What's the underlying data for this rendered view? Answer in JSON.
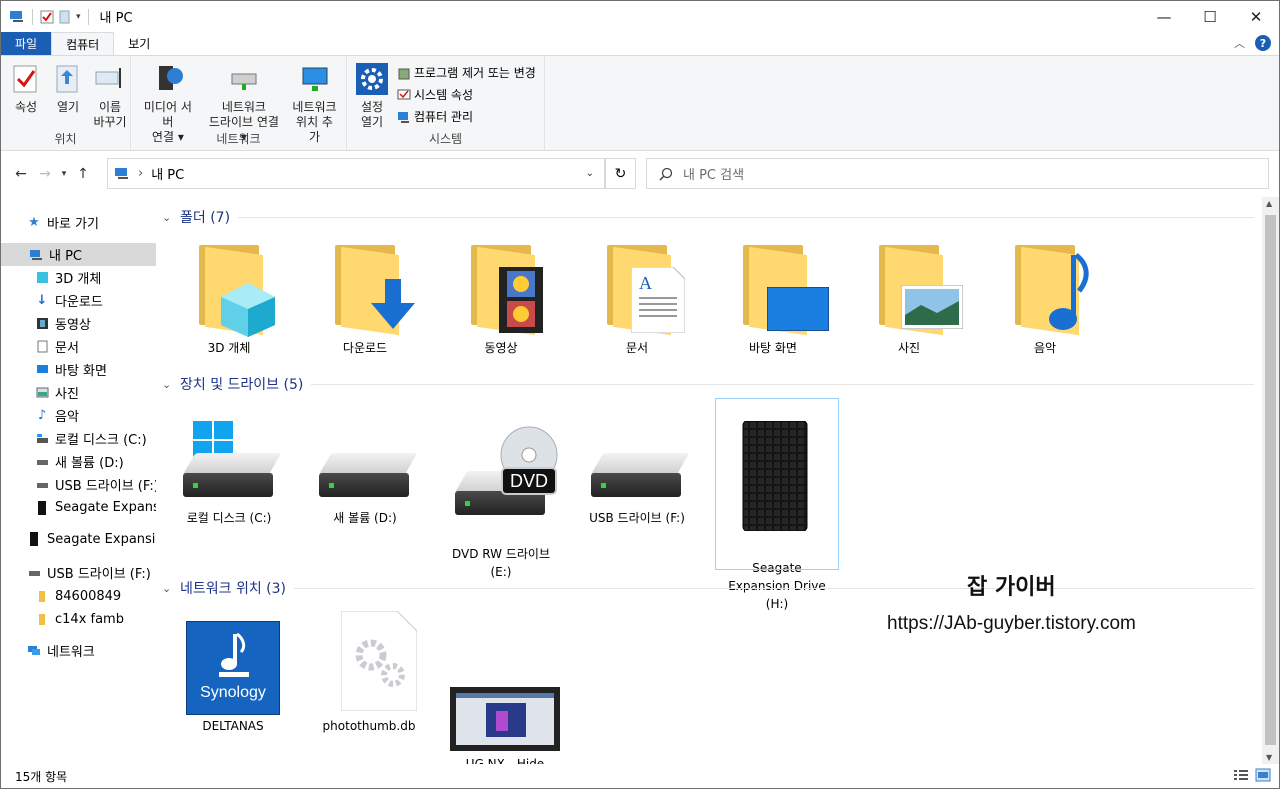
{
  "window": {
    "title": "내 PC"
  },
  "tabs": [
    {
      "label": "파일"
    },
    {
      "label": "컴퓨터"
    },
    {
      "label": "보기"
    }
  ],
  "ribbon": {
    "groups": [
      {
        "label": "위치",
        "buttons": [
          "속성",
          "열기",
          "이름\n바꾸기"
        ]
      },
      {
        "label": "네트워크",
        "buttons": [
          "미디어 서버\n연결 ▾",
          "네트워크\n드라이브 연결 ▾",
          "네트워크\n위치 추가"
        ]
      },
      {
        "label": "시스템",
        "big": "설정\n열기",
        "small": [
          "프로그램 제거 또는 변경",
          "시스템 속성",
          "컴퓨터 관리"
        ]
      }
    ]
  },
  "address": {
    "path": "내 PC",
    "search_placeholder": "내 PC 검색"
  },
  "nav": [
    {
      "label": "바로 가기",
      "icon": "star-icon"
    },
    {
      "label": "내 PC",
      "icon": "pc-icon",
      "selected": true
    },
    {
      "label": "3D 개체",
      "icon": "cube-icon"
    },
    {
      "label": "다운로드",
      "icon": "download-icon"
    },
    {
      "label": "동영상",
      "icon": "video-icon"
    },
    {
      "label": "문서",
      "icon": "document-icon"
    },
    {
      "label": "바탕 화면",
      "icon": "desktop-icon"
    },
    {
      "label": "사진",
      "icon": "picture-icon"
    },
    {
      "label": "음악",
      "icon": "music-icon"
    },
    {
      "label": "로컬 디스크 (C:)",
      "icon": "drive-c-icon"
    },
    {
      "label": "새 볼륨 (D:)",
      "icon": "drive-icon"
    },
    {
      "label": "USB 드라이브 (F:)",
      "icon": "usb-icon"
    },
    {
      "label": "Seagate Expansion",
      "icon": "seagate-icon"
    },
    {
      "label": "Seagate Expansion",
      "icon": "seagate-icon"
    },
    {
      "label": "USB 드라이브 (F:)",
      "icon": "usb-icon"
    },
    {
      "label": "84600849",
      "icon": "folder-icon"
    },
    {
      "label": "c14x famb",
      "icon": "folder-icon"
    },
    {
      "label": "네트워크",
      "icon": "network-icon"
    }
  ],
  "sections": {
    "folders": {
      "header": "폴더 (7)",
      "items": [
        "3D 개체",
        "다운로드",
        "동영상",
        "문서",
        "바탕 화면",
        "사진",
        "음악"
      ]
    },
    "drives": {
      "header": "장치 및 드라이브 (5)",
      "items": [
        "로컬 디스크 (C:)",
        "새 볼륨 (D:)",
        "DVD RW 드라이브\n(E:)",
        "USB 드라이브 (F:)",
        "Seagate\nExpansion Drive\n(H:)"
      ]
    },
    "network": {
      "header": "네트워크 위치 (3)",
      "items": [
        "DELTANAS",
        "photothumb.db",
        "UG NX - Hide\nComponents in\nview.avi"
      ]
    }
  },
  "icons_text": {
    "dvd": "DVD",
    "synology": "Synology"
  },
  "status": {
    "count": "15개 항목"
  },
  "watermark": {
    "title": "잡 가이버",
    "url": "https://JAb-guyber.tistory.com"
  },
  "colors": {
    "accent": "#1a5fb4",
    "folder": "#ffd86f",
    "header_text": "#1e3287"
  }
}
